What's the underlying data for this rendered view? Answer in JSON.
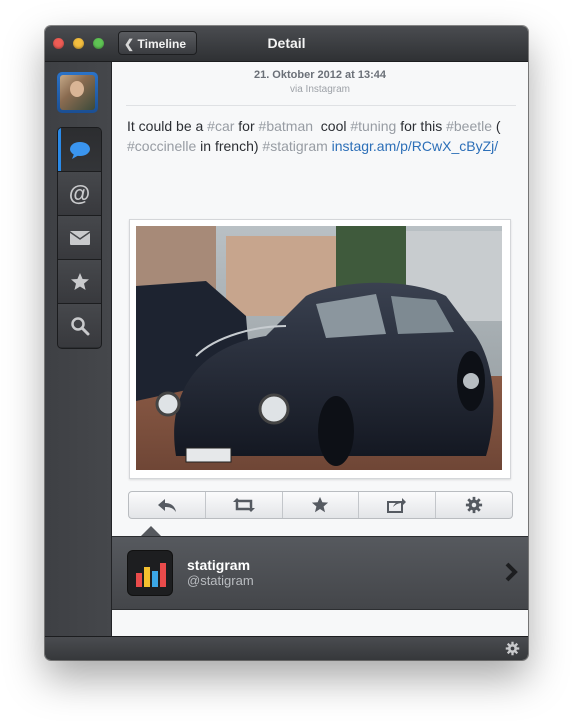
{
  "window": {
    "title": "Detail",
    "back_label": "Timeline"
  },
  "sidebar": {
    "items": [
      {
        "icon": "speech-bubble-icon",
        "active": true
      },
      {
        "icon": "at-icon",
        "label": "@"
      },
      {
        "icon": "envelope-icon"
      },
      {
        "icon": "star-icon"
      },
      {
        "icon": "search-icon"
      }
    ]
  },
  "tweet": {
    "date": "21. Oktober 2012 at 13:44",
    "via": "via Instagram",
    "text_segments": {
      "s1": "It could be a ",
      "t1": "#car",
      "s2": " for ",
      "t2": "#batman",
      "s3": "  cool ",
      "t3": "#tuning",
      "s4": " for this ",
      "t4": "#beetle",
      "s5": " ( ",
      "t5": "#coccinelle",
      "s6": " in french) ",
      "t6": "#statigram",
      "s7": " ",
      "link": "instagr.am/p/RCwX_cByZj/"
    },
    "photo_description_icon": "photo-thumbnail"
  },
  "actions": [
    "reply-icon",
    "retweet-icon",
    "star-icon",
    "share-icon",
    "gear-icon"
  ],
  "profile": {
    "name": "statigram",
    "handle": "@statigram"
  },
  "colors": {
    "accent": "#2a8ae8",
    "link": "#2c6fb8",
    "hashtag": "#979ca3"
  }
}
